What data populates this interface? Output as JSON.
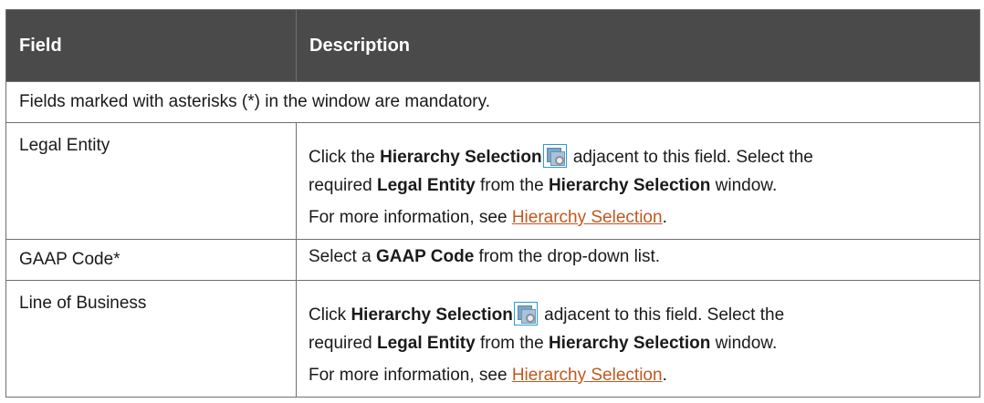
{
  "table": {
    "headers": {
      "field": "Field",
      "description": "Description"
    },
    "note": "Fields marked with asterisks (*) in the window are mandatory.",
    "rows": [
      {
        "field": "Legal Entity",
        "line1_pre": "Click the ",
        "line1_bold": "Hierarchy Selection",
        "line1_post": " adjacent to this field. Select the",
        "line2_pre": "required ",
        "line2_bold1": "Legal Entity",
        "line2_mid": " from the ",
        "line2_bold2": "Hierarchy Selection",
        "line2_post": " window.",
        "more_prefix": "For more information, see ",
        "more_link": "Hierarchy Selection",
        "more_suffix": "."
      },
      {
        "field": "GAAP Code*",
        "pre": "Select a ",
        "bold": "GAAP Code",
        "post": " from the drop-down list."
      },
      {
        "field": "Line of Business",
        "line1_pre": "Click ",
        "line1_bold": "Hierarchy Selection",
        "line1_post": " adjacent to this field. Select the",
        "line2_pre": "required ",
        "line2_bold1": "Legal Entity",
        "line2_mid": " from the ",
        "line2_bold2": "Hierarchy Selection",
        "line2_post": " window.",
        "more_prefix": "For more information, see ",
        "more_link": "Hierarchy Selection",
        "more_suffix": "."
      }
    ],
    "icon": "hierarchy-selection-icon",
    "colors": {
      "header_bg": "#4a4a4a",
      "header_text": "#ffffff",
      "link": "#c0581e",
      "border": "#707070"
    }
  }
}
